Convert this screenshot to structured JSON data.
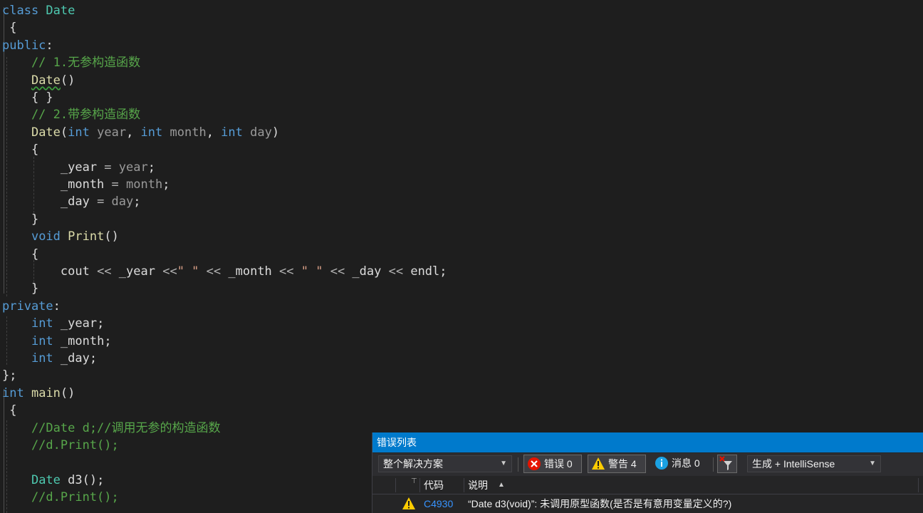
{
  "editor": {
    "lines": [
      [
        {
          "t": "class ",
          "c": "kw"
        },
        {
          "t": "Date",
          "c": "ty"
        }
      ],
      [
        {
          "t": " {",
          "c": "id"
        }
      ],
      [
        {
          "t": "public",
          "c": "kw"
        },
        {
          "t": ":",
          "c": "id"
        }
      ],
      [
        {
          "t": "    // 1.无参构造函数",
          "c": "cm"
        }
      ],
      [
        {
          "t": "    ",
          "c": "id"
        },
        {
          "t": "Date",
          "c": "fn",
          "sq": true
        },
        {
          "t": "()",
          "c": "id"
        }
      ],
      [
        {
          "t": "    { }",
          "c": "id"
        }
      ],
      [
        {
          "t": "    // 2.带参构造函数",
          "c": "cm"
        }
      ],
      [
        {
          "t": "    ",
          "c": "id"
        },
        {
          "t": "Date",
          "c": "fn"
        },
        {
          "t": "(",
          "c": "id"
        },
        {
          "t": "int",
          "c": "kw"
        },
        {
          "t": " year",
          "c": "pm"
        },
        {
          "t": ", ",
          "c": "id"
        },
        {
          "t": "int",
          "c": "kw"
        },
        {
          "t": " month",
          "c": "pm"
        },
        {
          "t": ", ",
          "c": "id"
        },
        {
          "t": "int",
          "c": "kw"
        },
        {
          "t": " day",
          "c": "pm"
        },
        {
          "t": ")",
          "c": "id"
        }
      ],
      [
        {
          "t": "    {",
          "c": "id"
        }
      ],
      [
        {
          "t": "        _year",
          "c": "id"
        },
        {
          "t": " = ",
          "c": "op"
        },
        {
          "t": "year",
          "c": "pm"
        },
        {
          "t": ";",
          "c": "id"
        }
      ],
      [
        {
          "t": "        _month",
          "c": "id"
        },
        {
          "t": " = ",
          "c": "op"
        },
        {
          "t": "month",
          "c": "pm"
        },
        {
          "t": ";",
          "c": "id"
        }
      ],
      [
        {
          "t": "        _day",
          "c": "id"
        },
        {
          "t": " = ",
          "c": "op"
        },
        {
          "t": "day",
          "c": "pm"
        },
        {
          "t": ";",
          "c": "id"
        }
      ],
      [
        {
          "t": "    }",
          "c": "id"
        }
      ],
      [
        {
          "t": "    ",
          "c": "id"
        },
        {
          "t": "void",
          "c": "kw"
        },
        {
          "t": " ",
          "c": "id"
        },
        {
          "t": "Print",
          "c": "fn"
        },
        {
          "t": "()",
          "c": "id"
        }
      ],
      [
        {
          "t": "    {",
          "c": "id"
        }
      ],
      [
        {
          "t": "        cout ",
          "c": "id"
        },
        {
          "t": "<<",
          "c": "op"
        },
        {
          "t": " _year ",
          "c": "id"
        },
        {
          "t": "<<",
          "c": "op"
        },
        {
          "t": "\" \"",
          "c": "st"
        },
        {
          "t": " ",
          "c": "id"
        },
        {
          "t": "<<",
          "c": "op"
        },
        {
          "t": " _month ",
          "c": "id"
        },
        {
          "t": "<<",
          "c": "op"
        },
        {
          "t": " \" \" ",
          "c": "st"
        },
        {
          "t": "<<",
          "c": "op"
        },
        {
          "t": " _day ",
          "c": "id"
        },
        {
          "t": "<<",
          "c": "op"
        },
        {
          "t": " endl;",
          "c": "id"
        }
      ],
      [
        {
          "t": "    }",
          "c": "id"
        }
      ],
      [
        {
          "t": "private",
          "c": "kw"
        },
        {
          "t": ":",
          "c": "id"
        }
      ],
      [
        {
          "t": "    ",
          "c": "id"
        },
        {
          "t": "int",
          "c": "kw"
        },
        {
          "t": " _year;",
          "c": "id"
        }
      ],
      [
        {
          "t": "    ",
          "c": "id"
        },
        {
          "t": "int",
          "c": "kw"
        },
        {
          "t": " _month;",
          "c": "id"
        }
      ],
      [
        {
          "t": "    ",
          "c": "id"
        },
        {
          "t": "int",
          "c": "kw"
        },
        {
          "t": " _day;",
          "c": "id"
        }
      ],
      [
        {
          "t": "};",
          "c": "id"
        }
      ],
      [
        {
          "t": "int",
          "c": "kw"
        },
        {
          "t": " ",
          "c": "id"
        },
        {
          "t": "main",
          "c": "fn"
        },
        {
          "t": "()",
          "c": "id"
        }
      ],
      [
        {
          "t": " {",
          "c": "id"
        }
      ],
      [
        {
          "t": "    //Date d;//调用无参的构造函数",
          "c": "cm"
        }
      ],
      [
        {
          "t": "    //d.Print();",
          "c": "cm"
        }
      ],
      [
        {
          "t": "",
          "c": "id"
        }
      ],
      [
        {
          "t": "    ",
          "c": "id"
        },
        {
          "t": "Date",
          "c": "ty"
        },
        {
          "t": " d3();",
          "c": "id"
        }
      ],
      [
        {
          "t": "    //d.Print();",
          "c": "cm"
        }
      ]
    ]
  },
  "error_list": {
    "title": "错误列表",
    "scope": "整个解决方案",
    "errors_label": "错误 0",
    "warnings_label": "警告 4",
    "messages_label": "消息 0",
    "build_filter": "生成 + IntelliSense",
    "columns": {
      "code": "代码",
      "description": "说明"
    },
    "rows": [
      {
        "code": "C4930",
        "description": "“Date d3(void)”: 未调用原型函数(是否是有意用变量定义的?)"
      }
    ],
    "colors": {
      "title_bar": "#007acc",
      "code_link": "#3794ff",
      "warning": "#ffcc00",
      "error": "#e51400",
      "info": "#1ba1e2"
    }
  }
}
